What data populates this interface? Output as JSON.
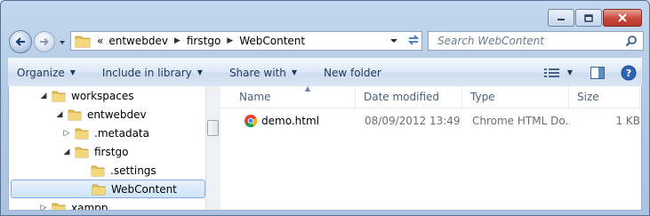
{
  "window": {
    "caption_buttons": [
      {
        "name": "minimize",
        "icon": "minimize-icon"
      },
      {
        "name": "maximize",
        "icon": "maximize-icon"
      },
      {
        "name": "close",
        "icon": "close-icon"
      }
    ]
  },
  "address": {
    "overflow": "«",
    "crumbs": [
      "entwebdev",
      "firstgo",
      "WebContent"
    ]
  },
  "search": {
    "placeholder": "Search WebContent"
  },
  "toolbar": {
    "organize": "Organize",
    "include_in_library": "Include in library",
    "share_with": "Share with",
    "new_folder": "New folder"
  },
  "tree": {
    "items": [
      {
        "label": "workspaces",
        "expander": "◢"
      },
      {
        "label": "entwebdev",
        "expander": "◢"
      },
      {
        "label": ".metadata",
        "expander": "▷"
      },
      {
        "label": "firstgo",
        "expander": "◢"
      },
      {
        "label": ".settings",
        "expander": ""
      },
      {
        "label": "WebContent",
        "expander": "",
        "selected": true
      },
      {
        "label": "xampp",
        "expander": "▷"
      }
    ]
  },
  "columns": {
    "name": "Name",
    "date_modified": "Date modified",
    "type": "Type",
    "size": "Size"
  },
  "files": [
    {
      "name": "demo.html",
      "date_modified": "08/09/2012 13:49",
      "type": "Chrome HTML Do...",
      "size": "1 KB",
      "icon": "chrome-html-icon"
    }
  ],
  "colors": {
    "frame": "#b4cbe5",
    "toolbar_text": "#1e395b",
    "selection": "#cde4fb",
    "close_button": "#c7473a"
  }
}
